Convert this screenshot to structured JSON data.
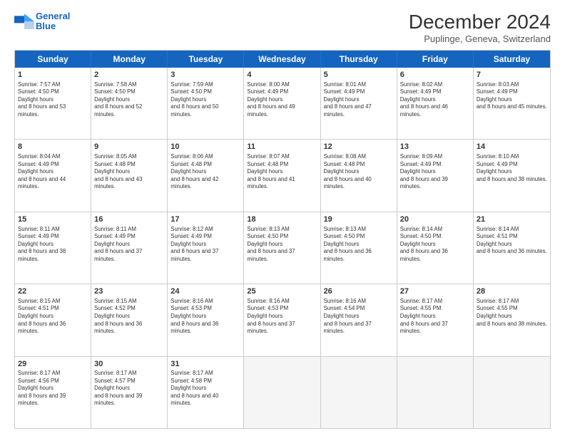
{
  "header": {
    "title": "December 2024",
    "subtitle": "Puplinge, Geneva, Switzerland",
    "logo_line1": "General",
    "logo_line2": "Blue"
  },
  "days": [
    "Sunday",
    "Monday",
    "Tuesday",
    "Wednesday",
    "Thursday",
    "Friday",
    "Saturday"
  ],
  "weeks": [
    [
      {
        "day": "1",
        "sunrise": "7:57 AM",
        "sunset": "4:50 PM",
        "daylight": "8 hours and 53 minutes."
      },
      {
        "day": "2",
        "sunrise": "7:58 AM",
        "sunset": "4:50 PM",
        "daylight": "8 hours and 52 minutes."
      },
      {
        "day": "3",
        "sunrise": "7:59 AM",
        "sunset": "4:50 PM",
        "daylight": "8 hours and 50 minutes."
      },
      {
        "day": "4",
        "sunrise": "8:00 AM",
        "sunset": "4:49 PM",
        "daylight": "8 hours and 49 minutes."
      },
      {
        "day": "5",
        "sunrise": "8:01 AM",
        "sunset": "4:49 PM",
        "daylight": "8 hours and 47 minutes."
      },
      {
        "day": "6",
        "sunrise": "8:02 AM",
        "sunset": "4:49 PM",
        "daylight": "8 hours and 46 minutes."
      },
      {
        "day": "7",
        "sunrise": "8:03 AM",
        "sunset": "4:49 PM",
        "daylight": "8 hours and 45 minutes."
      }
    ],
    [
      {
        "day": "8",
        "sunrise": "8:04 AM",
        "sunset": "4:49 PM",
        "daylight": "8 hours and 44 minutes."
      },
      {
        "day": "9",
        "sunrise": "8:05 AM",
        "sunset": "4:48 PM",
        "daylight": "8 hours and 43 minutes."
      },
      {
        "day": "10",
        "sunrise": "8:06 AM",
        "sunset": "4:48 PM",
        "daylight": "8 hours and 42 minutes."
      },
      {
        "day": "11",
        "sunrise": "8:07 AM",
        "sunset": "4:48 PM",
        "daylight": "8 hours and 41 minutes."
      },
      {
        "day": "12",
        "sunrise": "8:08 AM",
        "sunset": "4:48 PM",
        "daylight": "8 hours and 40 minutes."
      },
      {
        "day": "13",
        "sunrise": "8:09 AM",
        "sunset": "4:49 PM",
        "daylight": "8 hours and 39 minutes."
      },
      {
        "day": "14",
        "sunrise": "8:10 AM",
        "sunset": "4:49 PM",
        "daylight": "8 hours and 38 minutes."
      }
    ],
    [
      {
        "day": "15",
        "sunrise": "8:11 AM",
        "sunset": "4:49 PM",
        "daylight": "8 hours and 38 minutes."
      },
      {
        "day": "16",
        "sunrise": "8:11 AM",
        "sunset": "4:49 PM",
        "daylight": "8 hours and 37 minutes."
      },
      {
        "day": "17",
        "sunrise": "8:12 AM",
        "sunset": "4:49 PM",
        "daylight": "8 hours and 37 minutes."
      },
      {
        "day": "18",
        "sunrise": "8:13 AM",
        "sunset": "4:50 PM",
        "daylight": "8 hours and 37 minutes."
      },
      {
        "day": "19",
        "sunrise": "8:13 AM",
        "sunset": "4:50 PM",
        "daylight": "8 hours and 36 minutes."
      },
      {
        "day": "20",
        "sunrise": "8:14 AM",
        "sunset": "4:50 PM",
        "daylight": "8 hours and 36 minutes."
      },
      {
        "day": "21",
        "sunrise": "8:14 AM",
        "sunset": "4:51 PM",
        "daylight": "8 hours and 36 minutes."
      }
    ],
    [
      {
        "day": "22",
        "sunrise": "8:15 AM",
        "sunset": "4:51 PM",
        "daylight": "8 hours and 36 minutes."
      },
      {
        "day": "23",
        "sunrise": "8:15 AM",
        "sunset": "4:52 PM",
        "daylight": "8 hours and 36 minutes."
      },
      {
        "day": "24",
        "sunrise": "8:16 AM",
        "sunset": "4:53 PM",
        "daylight": "8 hours and 36 minutes."
      },
      {
        "day": "25",
        "sunrise": "8:16 AM",
        "sunset": "4:53 PM",
        "daylight": "8 hours and 37 minutes."
      },
      {
        "day": "26",
        "sunrise": "8:16 AM",
        "sunset": "4:54 PM",
        "daylight": "8 hours and 37 minutes."
      },
      {
        "day": "27",
        "sunrise": "8:17 AM",
        "sunset": "4:55 PM",
        "daylight": "8 hours and 37 minutes."
      },
      {
        "day": "28",
        "sunrise": "8:17 AM",
        "sunset": "4:55 PM",
        "daylight": "8 hours and 38 minutes."
      }
    ],
    [
      {
        "day": "29",
        "sunrise": "8:17 AM",
        "sunset": "4:56 PM",
        "daylight": "8 hours and 39 minutes."
      },
      {
        "day": "30",
        "sunrise": "8:17 AM",
        "sunset": "4:57 PM",
        "daylight": "8 hours and 39 minutes."
      },
      {
        "day": "31",
        "sunrise": "8:17 AM",
        "sunset": "4:58 PM",
        "daylight": "8 hours and 40 minutes."
      },
      null,
      null,
      null,
      null
    ]
  ]
}
